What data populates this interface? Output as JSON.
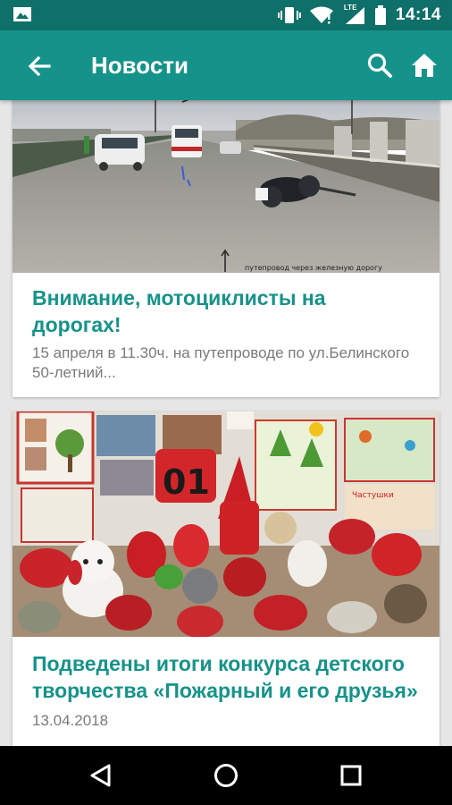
{
  "status": {
    "time": "14:14",
    "network_label": "LTE"
  },
  "app_bar": {
    "title": "Новости"
  },
  "news": [
    {
      "title": "Внимание, мотоциклисты на дорогах!",
      "excerpt": "15 апреля в 11.30ч. на путепроводе по ул.Белинского 50-летний...",
      "image_caption": "путепровод через железную дорогу"
    },
    {
      "title": "Подведены итоги конкурса детского творчества «Пожарный и его друзья»",
      "date": "13.04.2018"
    }
  ],
  "colors": {
    "status_bar": "#0f6f69",
    "app_bar": "#15938a",
    "accent": "#15938a"
  },
  "icons": {
    "back": "arrow-back-icon",
    "search": "search-icon",
    "home": "home-icon",
    "nav_back": "triangle-back-icon",
    "nav_home": "circle-home-icon",
    "nav_recents": "square-recents-icon"
  }
}
